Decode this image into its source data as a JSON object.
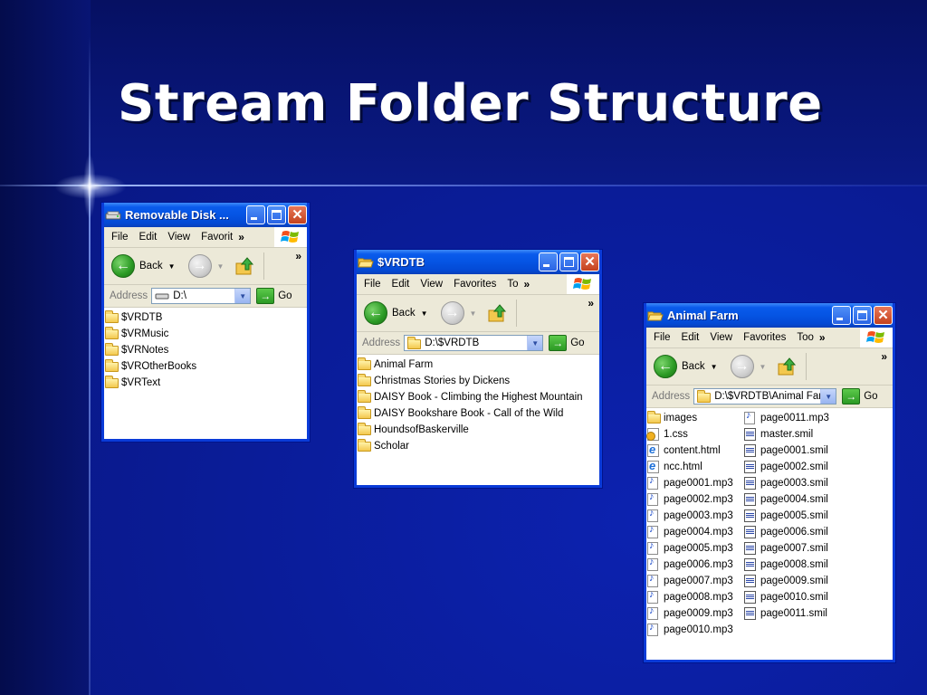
{
  "slide": {
    "title": "Stream Folder Structure"
  },
  "colors": {
    "titlebar": "#0554e3",
    "border": "#0a3bd8",
    "menubar": "#ece9d8",
    "go": "#2b9a24"
  },
  "windows": {
    "w1": {
      "title": "Removable Disk ...",
      "menus": [
        "File",
        "Edit",
        "View",
        "Favorit"
      ],
      "back": "Back",
      "address_label": "Address",
      "address_value": "D:\\",
      "go": "Go",
      "items": [
        {
          "name": "$VRDTB",
          "icon": "folder-icon"
        },
        {
          "name": "$VRMusic",
          "icon": "folder-icon"
        },
        {
          "name": "$VRNotes",
          "icon": "folder-icon"
        },
        {
          "name": "$VROtherBooks",
          "icon": "folder-icon"
        },
        {
          "name": "$VRText",
          "icon": "folder-icon"
        }
      ]
    },
    "w2": {
      "title": "$VRDTB",
      "menus": [
        "File",
        "Edit",
        "View",
        "Favorites",
        "To"
      ],
      "back": "Back",
      "address_label": "Address",
      "address_value": "D:\\$VRDTB",
      "go": "Go",
      "items": [
        {
          "name": "Animal Farm",
          "icon": "folder-icon"
        },
        {
          "name": "Christmas Stories by Dickens",
          "icon": "folder-icon"
        },
        {
          "name": "DAISY Book - Climbing the Highest Mountain",
          "icon": "folder-icon"
        },
        {
          "name": "DAISY Bookshare Book - Call of the Wild",
          "icon": "folder-icon"
        },
        {
          "name": "HoundsofBaskerville",
          "icon": "folder-icon"
        },
        {
          "name": "Scholar",
          "icon": "folder-icon"
        }
      ]
    },
    "w3": {
      "title": "Animal Farm",
      "menus": [
        "File",
        "Edit",
        "View",
        "Favorites",
        "Too"
      ],
      "back": "Back",
      "address_label": "Address",
      "address_value": "D:\\$VRDTB\\Animal Farm",
      "go": "Go",
      "col1": [
        {
          "name": "images",
          "icon": "folder-icon"
        },
        {
          "name": "1.css",
          "icon": "css-file-icon"
        },
        {
          "name": "content.html",
          "icon": "html-file-icon"
        },
        {
          "name": "ncc.html",
          "icon": "html-file-icon"
        },
        {
          "name": "page0001.mp3",
          "icon": "mp3-file-icon"
        },
        {
          "name": "page0002.mp3",
          "icon": "mp3-file-icon"
        },
        {
          "name": "page0003.mp3",
          "icon": "mp3-file-icon"
        },
        {
          "name": "page0004.mp3",
          "icon": "mp3-file-icon"
        },
        {
          "name": "page0005.mp3",
          "icon": "mp3-file-icon"
        },
        {
          "name": "page0006.mp3",
          "icon": "mp3-file-icon"
        },
        {
          "name": "page0007.mp3",
          "icon": "mp3-file-icon"
        },
        {
          "name": "page0008.mp3",
          "icon": "mp3-file-icon"
        },
        {
          "name": "page0009.mp3",
          "icon": "mp3-file-icon"
        },
        {
          "name": "page0010.mp3",
          "icon": "mp3-file-icon"
        }
      ],
      "col2": [
        {
          "name": "page0011.mp3",
          "icon": "mp3-file-icon"
        },
        {
          "name": "master.smil",
          "icon": "smil-file-icon"
        },
        {
          "name": "page0001.smil",
          "icon": "smil-file-icon"
        },
        {
          "name": "page0002.smil",
          "icon": "smil-file-icon"
        },
        {
          "name": "page0003.smil",
          "icon": "smil-file-icon"
        },
        {
          "name": "page0004.smil",
          "icon": "smil-file-icon"
        },
        {
          "name": "page0005.smil",
          "icon": "smil-file-icon"
        },
        {
          "name": "page0006.smil",
          "icon": "smil-file-icon"
        },
        {
          "name": "page0007.smil",
          "icon": "smil-file-icon"
        },
        {
          "name": "page0008.smil",
          "icon": "smil-file-icon"
        },
        {
          "name": "page0009.smil",
          "icon": "smil-file-icon"
        },
        {
          "name": "page0010.smil",
          "icon": "smil-file-icon"
        },
        {
          "name": "page0011.smil",
          "icon": "smil-file-icon"
        }
      ]
    }
  }
}
